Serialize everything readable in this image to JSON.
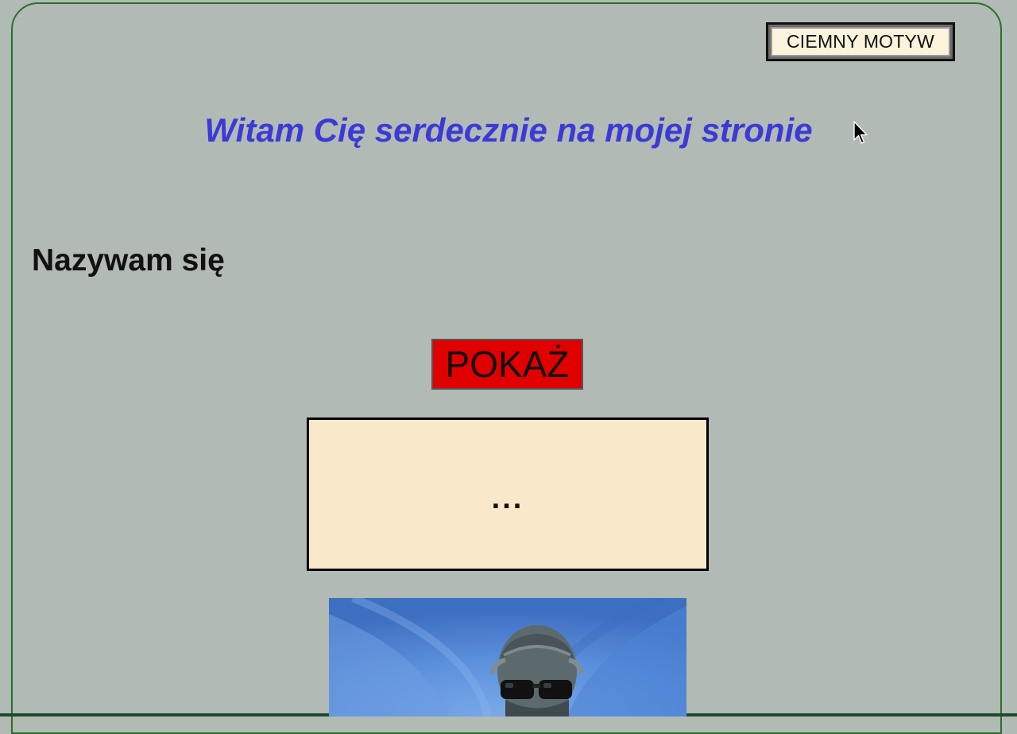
{
  "header": {
    "theme_button_label": "CIEMNY MOTYW"
  },
  "main": {
    "welcome_title": "Witam Cię serdecznie na mojej stronie",
    "name_heading": "Nazywam się",
    "show_button_label": "POKAŻ",
    "message_text": "..."
  },
  "colors": {
    "background": "#b1bab5",
    "frame_border": "#2b6f2b",
    "title": "#3c3ad6",
    "show_button": "#e00000",
    "message_box": "#f9e8c9",
    "theme_button": "#fbf3dc"
  },
  "icons": {
    "cursor": "mouse-pointer-icon"
  }
}
